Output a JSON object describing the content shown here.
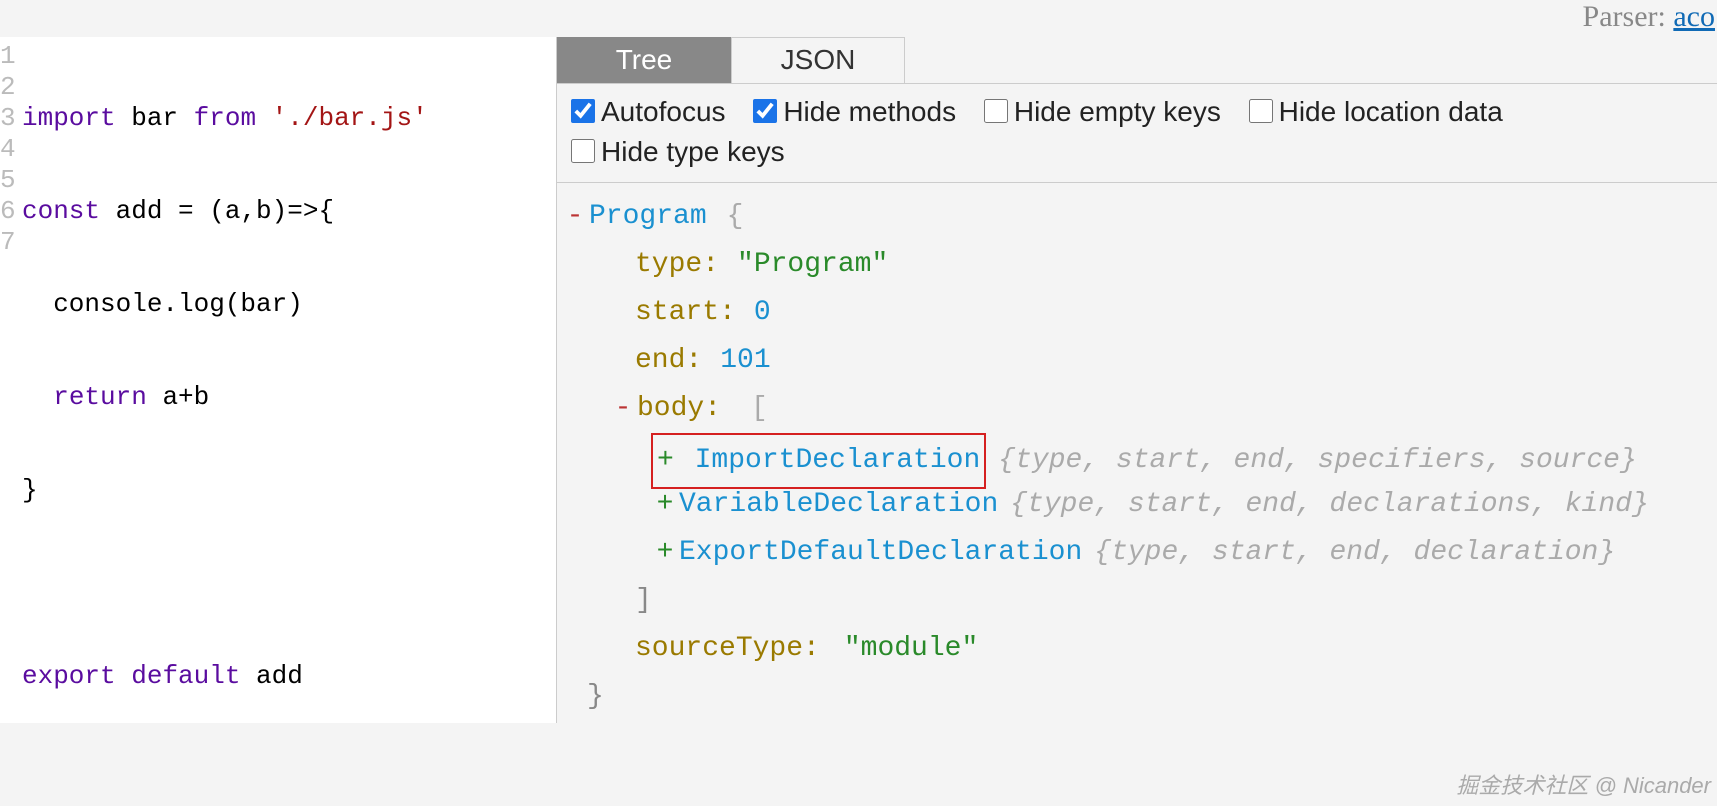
{
  "topbar": {
    "label": "Parser: ",
    "link": "aco"
  },
  "tabs": {
    "tree": "Tree",
    "json": "JSON"
  },
  "options": {
    "autofocus": "Autofocus",
    "hidemethods": "Hide methods",
    "hideempty": "Hide empty keys",
    "hideloc": "Hide location data",
    "hidetype": "Hide type keys"
  },
  "code": {
    "lines": [
      "1",
      "2",
      "3",
      "4",
      "5",
      "6",
      "7"
    ],
    "l1": {
      "a": "import",
      "b": " bar ",
      "c": "from",
      "d": " './bar.js'"
    },
    "l2": {
      "a": "const",
      "b": " add = (a,b)=>{"
    },
    "l3": {
      "a": "  console.log(bar)"
    },
    "l4": {
      "a": "  ",
      "b": "return",
      "c": " a+b"
    },
    "l5": {
      "a": "}"
    },
    "l6": {
      "a": ""
    },
    "l7": {
      "a": "export",
      "b": " ",
      "c": "default",
      "d": " add"
    }
  },
  "ast": {
    "root": "Program",
    "obrace": "{",
    "cbrace": "}",
    "obrack": "[",
    "cbrack": "]",
    "type_k": "type:",
    "type_v": "\"Program\"",
    "start_k": "start:",
    "start_v": "0",
    "end_k": "end:",
    "end_v": "101",
    "body_k": "body:",
    "n1": "ImportDeclaration",
    "n1_hint": "{type, start, end, specifiers, source}",
    "n2": "VariableDeclaration",
    "n2_hint": "{type, start, end, declarations, kind}",
    "n3": "ExportDefaultDeclaration",
    "n3_hint": "{type, start, end, declaration}",
    "st_k": "sourceType:",
    "st_v": "\"module\"",
    "minus": "-",
    "plus": "+"
  },
  "watermark": "掘金技术社区 @ Nicander"
}
